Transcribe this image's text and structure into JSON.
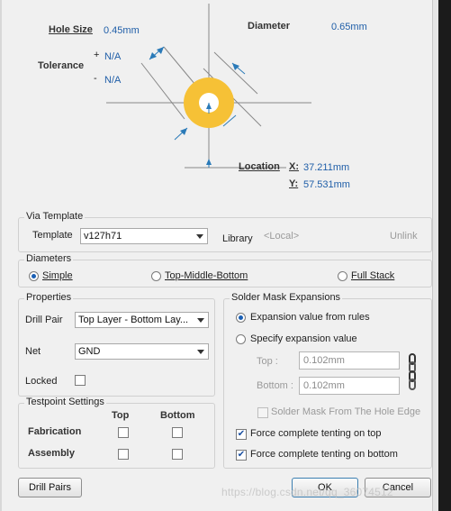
{
  "top": {
    "hole_size_label": "Hole Size",
    "hole_size_value": "0.45mm",
    "diameter_label": "Diameter",
    "diameter_value": "0.65mm",
    "tolerance_label": "Tolerance",
    "tol_plus_sign": "+",
    "tol_plus_value": "N/A",
    "tol_minus_sign": "-",
    "tol_minus_value": "N/A",
    "location_label": "Location",
    "x_label": "X:",
    "x_value": "37.211mm",
    "y_label": "Y:",
    "y_value": "57.531mm",
    "pad_color": "#f6c136"
  },
  "via_template": {
    "title": "Via Template",
    "template_label": "Template",
    "template_value": "v127h71",
    "library_label": "Library",
    "library_value": "<Local>",
    "unlink_label": "Unlink"
  },
  "diameters": {
    "title": "Diameters",
    "options": [
      "Simple",
      "Top-Middle-Bottom",
      "Full Stack"
    ],
    "selected": "Simple"
  },
  "properties": {
    "title": "Properties",
    "drill_pair_label": "Drill Pair",
    "drill_pair_value": "Top Layer - Bottom Lay...",
    "net_label": "Net",
    "net_value": "GND",
    "locked_label": "Locked"
  },
  "testpoint": {
    "title": "Testpoint Settings",
    "col_top": "Top",
    "col_bottom": "Bottom",
    "row_fabrication": "Fabrication",
    "row_assembly": "Assembly"
  },
  "solder_mask": {
    "title": "Solder Mask Expansions",
    "opt_rules": "Expansion value from rules",
    "opt_specify": "Specify expansion value",
    "top_label": "Top :",
    "top_value": "0.102mm",
    "bottom_label": "Bottom :",
    "bottom_value": "0.102mm",
    "from_hole_edge": "Solder Mask From The Hole Edge",
    "tent_top": "Force complete tenting on top",
    "tent_bottom": "Force complete tenting on bottom"
  },
  "buttons": {
    "drill_pairs": "Drill Pairs",
    "ok": "OK",
    "cancel": "Cancel"
  },
  "watermark": "https://blog.csdn.net/qq_36074512"
}
